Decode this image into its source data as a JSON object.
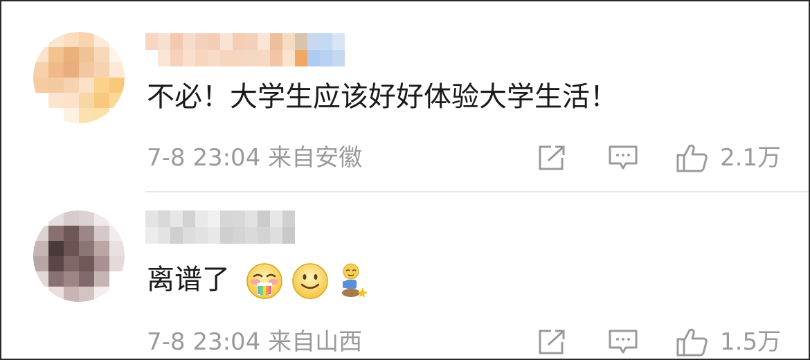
{
  "comments": [
    {
      "text": "不必！大学生应该好好体验大学生活！",
      "timestamp_location": "7-8 23:04 来自安徽",
      "like_count": "2.1万",
      "emojis": []
    },
    {
      "text": "离谱了",
      "timestamp_location": "7-8 23:04 来自山西",
      "like_count": "1.5万",
      "emojis": [
        "vomit-rainbow-emoji",
        "smile-emoji",
        "kneeling-figure-emoji"
      ]
    }
  ],
  "icons": {
    "share": "share-icon",
    "comment": "comment-icon",
    "like": "thumbs-up-icon"
  },
  "colors": {
    "text_primary": "#1a1a1a",
    "text_secondary": "#9a9a9a",
    "divider": "#e6e6e6",
    "icon": "#9a9a9a"
  }
}
